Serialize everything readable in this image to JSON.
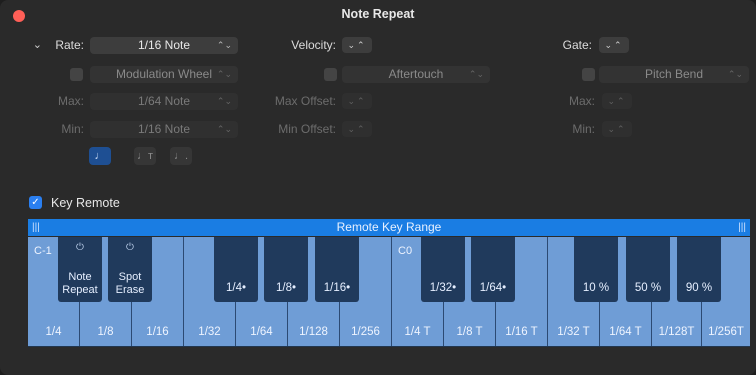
{
  "window": {
    "title": "Note Repeat"
  },
  "row1": {
    "rate_label": "Rate:",
    "rate_value": "1/16 Note",
    "velocity_label": "Velocity:",
    "gate_label": "Gate:"
  },
  "row2": {
    "mod_source": "Modulation Wheel",
    "velocity_source": "Aftertouch",
    "gate_source": "Pitch Bend"
  },
  "row3": {
    "max_label": "Max:",
    "max_value": "1/64 Note",
    "max_offset_label": "Max Offset:",
    "gate_max_label": "Max:"
  },
  "row4": {
    "min_label": "Min:",
    "min_value": "1/16 Note",
    "min_offset_label": "Min Offset:",
    "gate_min_label": "Min:"
  },
  "note_buttons": [
    "♩",
    "♩т",
    "♩."
  ],
  "key_remote": {
    "label": "Key Remote",
    "checked": true
  },
  "range_bar": {
    "label": "Remote Key Range"
  },
  "keyboard": {
    "octave_labels": [
      "C-1",
      "C0"
    ],
    "white_keys": [
      "1/4",
      "1/8",
      "1/16",
      "1/32",
      "1/64",
      "1/128",
      "1/256",
      "1/4 T",
      "1/8 T",
      "1/16 T",
      "1/32 T",
      "1/64 T",
      "1/128T",
      "1/256T"
    ],
    "black_keys": [
      {
        "label": "Note Repeat",
        "line1": "Note",
        "line2": "Repeat",
        "power": true
      },
      {
        "label": "Spot Erase",
        "line1": "Spot",
        "line2": "Erase",
        "power": true
      },
      {
        "label": "1/4•"
      },
      {
        "label": "1/8•"
      },
      {
        "label": "1/16•"
      },
      {
        "label": "1/32•"
      },
      {
        "label": "1/64•"
      },
      {
        "label": "10 %"
      },
      {
        "label": "50 %"
      },
      {
        "label": "90 %"
      }
    ],
    "power_glyph": "⏻"
  },
  "colors": {
    "accent": "#1a7de3",
    "white_key": "#6f9dd6",
    "black_key": "#203a5c",
    "close": "#ff5f57"
  }
}
